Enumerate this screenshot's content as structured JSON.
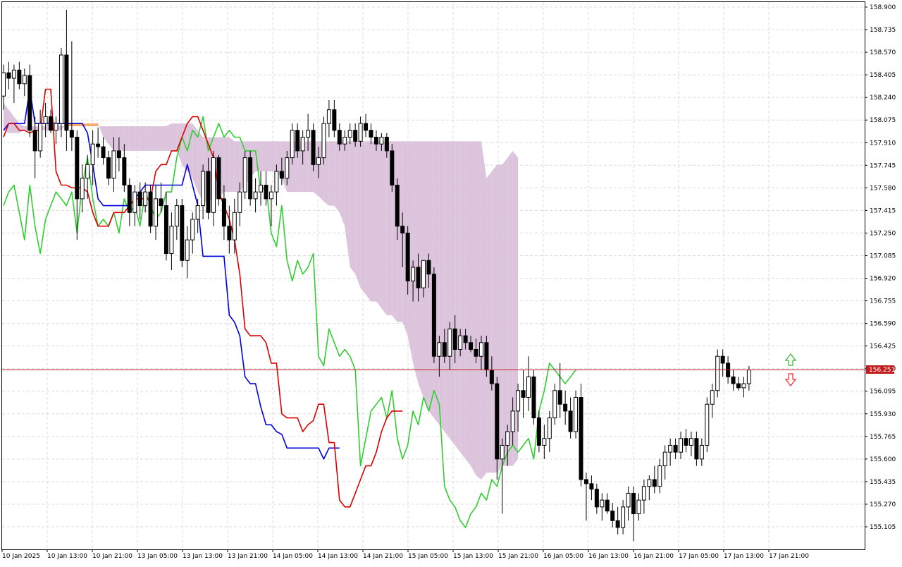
{
  "chart_data": {
    "type": "candlestick",
    "indicator": "Ichimoku Kinko Hyo",
    "current_price": "156.251",
    "price_label": "156.251",
    "ylim": [
      155.0,
      158.95
    ],
    "y_ticks": [
      "158.900",
      "158.735",
      "158.570",
      "158.405",
      "158.240",
      "158.075",
      "157.910",
      "157.745",
      "157.580",
      "157.415",
      "157.250",
      "157.085",
      "156.920",
      "156.755",
      "156.590",
      "156.425",
      "156.260",
      "156.095",
      "155.930",
      "155.765",
      "155.600",
      "155.435",
      "155.270",
      "155.105"
    ],
    "x_ticks": [
      "10 Jan 2025",
      "10 Jan 13:00",
      "10 Jan 21:00",
      "13 Jan 05:00",
      "13 Jan 13:00",
      "13 Jan 21:00",
      "14 Jan 05:00",
      "14 Jan 13:00",
      "14 Jan 21:00",
      "15 Jan 05:00",
      "15 Jan 13:00",
      "15 Jan 21:00",
      "16 Jan 05:00",
      "16 Jan 13:00",
      "16 Jan 21:00",
      "17 Jan 05:00",
      "17 Jan 13:00",
      "17 Jan 21:00"
    ],
    "candles_ohlc": [
      [
        158.25,
        158.48,
        158.15,
        158.42
      ],
      [
        158.42,
        158.5,
        158.3,
        158.38
      ],
      [
        158.38,
        158.48,
        158.2,
        158.44
      ],
      [
        158.44,
        158.5,
        158.3,
        158.34
      ],
      [
        158.34,
        158.45,
        158.25,
        158.4
      ],
      [
        158.4,
        158.48,
        157.95,
        158.0
      ],
      [
        158.0,
        158.1,
        157.65,
        157.85
      ],
      [
        157.85,
        158.15,
        157.8,
        158.05
      ],
      [
        158.05,
        158.2,
        157.95,
        158.1
      ],
      [
        158.1,
        158.15,
        157.98,
        158.0
      ],
      [
        158.0,
        158.1,
        157.9,
        158.05
      ],
      [
        158.05,
        158.6,
        157.95,
        158.55
      ],
      [
        158.55,
        158.88,
        157.85,
        158.0
      ],
      [
        158.0,
        158.65,
        157.85,
        157.95
      ],
      [
        157.95,
        158.0,
        157.2,
        157.5
      ],
      [
        157.5,
        157.75,
        157.4,
        157.65
      ],
      [
        157.65,
        157.82,
        157.5,
        157.75
      ],
      [
        157.75,
        158.0,
        157.6,
        157.9
      ],
      [
        157.9,
        158.02,
        157.8,
        157.88
      ],
      [
        157.88,
        157.95,
        157.75,
        157.8
      ],
      [
        157.8,
        157.85,
        157.6,
        157.65
      ],
      [
        157.65,
        157.95,
        157.55,
        157.85
      ],
      [
        157.85,
        157.95,
        157.7,
        157.8
      ],
      [
        157.8,
        157.9,
        157.55,
        157.6
      ],
      [
        157.6,
        157.65,
        157.3,
        157.4
      ],
      [
        157.4,
        157.6,
        157.3,
        157.55
      ],
      [
        157.55,
        157.62,
        157.35,
        157.45
      ],
      [
        157.45,
        157.62,
        157.4,
        157.55
      ],
      [
        157.55,
        157.6,
        157.25,
        157.3
      ],
      [
        157.3,
        157.6,
        157.2,
        157.5
      ],
      [
        157.5,
        157.62,
        157.4,
        157.45
      ],
      [
        157.45,
        157.55,
        157.05,
        157.1
      ],
      [
        157.1,
        157.4,
        156.98,
        157.3
      ],
      [
        157.3,
        157.5,
        157.2,
        157.45
      ],
      [
        157.45,
        157.5,
        157.0,
        157.05
      ],
      [
        157.05,
        157.3,
        156.92,
        157.2
      ],
      [
        157.2,
        157.4,
        157.1,
        157.35
      ],
      [
        157.35,
        157.5,
        157.25,
        157.45
      ],
      [
        157.45,
        157.75,
        157.35,
        157.7
      ],
      [
        157.7,
        157.8,
        157.35,
        157.4
      ],
      [
        157.4,
        157.85,
        157.3,
        157.8
      ],
      [
        157.8,
        157.82,
        157.45,
        157.5
      ],
      [
        157.5,
        157.6,
        157.2,
        157.3
      ],
      [
        157.3,
        157.45,
        157.1,
        157.2
      ],
      [
        157.2,
        157.5,
        157.1,
        157.4
      ],
      [
        157.4,
        157.62,
        157.3,
        157.55
      ],
      [
        157.55,
        157.85,
        157.5,
        157.8
      ],
      [
        157.8,
        157.85,
        157.45,
        157.5
      ],
      [
        157.5,
        157.65,
        157.4,
        157.55
      ],
      [
        157.55,
        157.7,
        157.45,
        157.6
      ],
      [
        157.6,
        157.7,
        157.45,
        157.5
      ],
      [
        157.5,
        157.6,
        157.3,
        157.55
      ],
      [
        157.55,
        157.75,
        157.45,
        157.7
      ],
      [
        157.7,
        157.8,
        157.6,
        157.65
      ],
      [
        157.65,
        157.85,
        157.6,
        157.8
      ],
      [
        157.8,
        158.05,
        157.75,
        158.0
      ],
      [
        158.0,
        158.05,
        157.8,
        157.85
      ],
      [
        157.85,
        158.0,
        157.75,
        157.95
      ],
      [
        157.95,
        158.12,
        157.85,
        158.0
      ],
      [
        158.0,
        158.05,
        157.7,
        157.75
      ],
      [
        157.75,
        157.88,
        157.65,
        157.8
      ],
      [
        157.8,
        158.1,
        157.75,
        158.05
      ],
      [
        158.05,
        158.22,
        157.95,
        158.15
      ],
      [
        158.15,
        158.22,
        157.95,
        158.0
      ],
      [
        158.0,
        158.05,
        157.85,
        157.9
      ],
      [
        157.9,
        158.0,
        157.85,
        157.95
      ],
      [
        157.95,
        158.05,
        157.9,
        158.0
      ],
      [
        158.0,
        158.05,
        157.88,
        157.92
      ],
      [
        157.92,
        158.1,
        157.88,
        158.05
      ],
      [
        158.05,
        158.12,
        157.95,
        158.0
      ],
      [
        158.0,
        158.05,
        157.9,
        157.95
      ],
      [
        157.95,
        158.0,
        157.85,
        157.9
      ],
      [
        157.9,
        157.98,
        157.85,
        157.95
      ],
      [
        157.95,
        157.98,
        157.8,
        157.85
      ],
      [
        157.85,
        157.9,
        157.55,
        157.6
      ],
      [
        157.6,
        157.65,
        157.2,
        157.3
      ],
      [
        157.3,
        157.4,
        157.0,
        157.25
      ],
      [
        157.25,
        157.3,
        156.8,
        156.9
      ],
      [
        156.9,
        157.05,
        156.75,
        157.0
      ],
      [
        157.0,
        157.1,
        156.75,
        156.85
      ],
      [
        156.85,
        157.05,
        156.78,
        157.05
      ],
      [
        157.05,
        157.1,
        156.85,
        156.95
      ],
      [
        156.95,
        157.0,
        156.3,
        156.35
      ],
      [
        156.35,
        156.5,
        156.2,
        156.45
      ],
      [
        156.45,
        156.55,
        156.3,
        156.35
      ],
      [
        156.35,
        156.6,
        156.25,
        156.55
      ],
      [
        156.55,
        156.65,
        156.3,
        156.4
      ],
      [
        156.4,
        156.55,
        156.35,
        156.5
      ],
      [
        156.5,
        156.55,
        156.4,
        156.45
      ],
      [
        156.45,
        156.5,
        156.38,
        156.4
      ],
      [
        156.4,
        156.48,
        156.3,
        156.35
      ],
      [
        156.35,
        156.5,
        156.25,
        156.45
      ],
      [
        156.45,
        156.5,
        156.2,
        156.25
      ],
      [
        156.25,
        156.35,
        156.1,
        156.15
      ],
      [
        156.15,
        156.2,
        155.45,
        155.6
      ],
      [
        155.6,
        155.75,
        155.2,
        155.7
      ],
      [
        155.7,
        155.85,
        155.55,
        155.8
      ],
      [
        155.8,
        156.05,
        155.7,
        155.95
      ],
      [
        155.95,
        156.15,
        155.8,
        156.1
      ],
      [
        156.1,
        156.25,
        155.9,
        156.05
      ],
      [
        156.05,
        156.35,
        155.95,
        156.2
      ],
      [
        156.2,
        156.25,
        155.85,
        155.9
      ],
      [
        155.9,
        155.95,
        155.65,
        155.7
      ],
      [
        155.7,
        155.85,
        155.6,
        155.75
      ],
      [
        155.75,
        155.95,
        155.65,
        155.9
      ],
      [
        155.9,
        156.15,
        155.85,
        156.1
      ],
      [
        156.1,
        156.3,
        155.9,
        156.0
      ],
      [
        156.0,
        156.1,
        155.85,
        155.95
      ],
      [
        155.95,
        156.05,
        155.75,
        155.8
      ],
      [
        155.8,
        156.1,
        155.75,
        156.05
      ],
      [
        156.05,
        156.15,
        155.4,
        155.45
      ],
      [
        155.45,
        155.5,
        155.15,
        155.42
      ],
      [
        155.42,
        155.48,
        155.3,
        155.38
      ],
      [
        155.38,
        155.42,
        155.2,
        155.25
      ],
      [
        155.25,
        155.35,
        155.15,
        155.3
      ],
      [
        155.3,
        155.35,
        155.2,
        155.22
      ],
      [
        155.22,
        155.28,
        155.1,
        155.15
      ],
      [
        155.15,
        155.25,
        155.05,
        155.1
      ],
      [
        155.1,
        155.3,
        155.05,
        155.25
      ],
      [
        155.25,
        155.4,
        155.15,
        155.35
      ],
      [
        155.35,
        155.4,
        155.0,
        155.2
      ],
      [
        155.2,
        155.35,
        155.15,
        155.3
      ],
      [
        155.3,
        155.45,
        155.2,
        155.4
      ],
      [
        155.4,
        155.48,
        155.3,
        155.45
      ],
      [
        155.45,
        155.55,
        155.35,
        155.4
      ],
      [
        155.4,
        155.6,
        155.35,
        155.55
      ],
      [
        155.55,
        155.7,
        155.45,
        155.65
      ],
      [
        155.65,
        155.75,
        155.55,
        155.7
      ],
      [
        155.7,
        155.75,
        155.6,
        155.65
      ],
      [
        155.65,
        155.8,
        155.6,
        155.75
      ],
      [
        155.75,
        155.82,
        155.65,
        155.7
      ],
      [
        155.7,
        155.8,
        155.62,
        155.75
      ],
      [
        155.75,
        155.8,
        155.55,
        155.6
      ],
      [
        155.6,
        155.75,
        155.55,
        155.7
      ],
      [
        155.7,
        156.05,
        155.65,
        156.0
      ],
      [
        156.0,
        156.15,
        155.9,
        156.1
      ],
      [
        156.1,
        156.4,
        156.05,
        156.35
      ],
      [
        156.35,
        156.4,
        156.2,
        156.3
      ],
      [
        156.3,
        156.35,
        156.15,
        156.2
      ],
      [
        156.2,
        156.25,
        156.1,
        156.15
      ],
      [
        156.15,
        156.2,
        156.1,
        156.12
      ],
      [
        156.12,
        156.2,
        156.05,
        156.15
      ],
      [
        156.15,
        156.28,
        156.1,
        156.25
      ]
    ],
    "tenkan_sen": [
      157.95,
      158.05,
      158.05,
      158.0,
      158.0,
      157.98,
      158.0,
      158.0,
      158.3,
      158.3,
      157.7,
      157.6,
      157.6,
      157.58,
      157.58,
      157.58,
      157.55,
      157.4,
      157.3,
      157.3,
      157.3,
      157.4,
      157.4,
      157.4,
      157.45,
      157.5,
      157.5,
      157.5,
      157.5,
      157.7,
      157.75,
      157.75,
      157.85,
      157.85,
      157.95,
      158.05,
      158.1,
      158.1,
      158.0,
      157.9,
      157.8,
      157.55,
      157.45,
      157.35,
      157.2,
      156.95,
      156.55,
      156.5,
      156.5,
      156.5,
      156.45,
      156.3,
      156.3,
      155.93,
      155.9,
      155.9,
      155.9,
      155.8,
      155.85,
      155.88,
      156.0,
      156.0,
      155.72,
      155.72,
      155.3,
      155.25,
      155.25,
      155.35,
      155.45,
      155.55,
      155.55,
      155.65,
      155.8,
      155.9,
      155.95,
      155.95,
      155.95
    ],
    "kijun_sen": [
      158.0,
      158.05,
      158.05,
      158.05,
      158.05,
      158.3,
      158.05,
      158.05,
      158.05,
      158.05,
      158.05,
      158.05,
      158.05,
      158.05,
      158.05,
      158.05,
      157.98,
      157.75,
      157.5,
      157.45,
      157.45,
      157.45,
      157.45,
      157.45,
      157.45,
      157.5,
      157.55,
      157.6,
      157.6,
      157.6,
      157.6,
      157.6,
      157.6,
      157.6,
      157.6,
      157.75,
      157.6,
      157.45,
      157.08,
      157.08,
      157.08,
      157.08,
      157.08,
      156.65,
      156.6,
      156.5,
      156.2,
      156.15,
      156.15,
      155.98,
      155.85,
      155.85,
      155.8,
      155.78,
      155.68,
      155.68,
      155.68,
      155.68,
      155.68,
      155.68,
      155.68,
      155.6,
      155.68,
      155.68,
      155.68
    ],
    "chikou_span": [
      157.45,
      157.55,
      157.6,
      157.4,
      157.2,
      157.6,
      157.3,
      157.1,
      157.35,
      157.45,
      157.55,
      157.5,
      157.45,
      157.55,
      157.25,
      157.6,
      157.8,
      157.5,
      157.3,
      157.35,
      157.3,
      157.4,
      157.25,
      157.5,
      157.4,
      157.45,
      157.3,
      157.55,
      157.45,
      157.35,
      157.4,
      157.55,
      157.55,
      157.8,
      157.95,
      157.85,
      158.0,
      157.95,
      158.1,
      157.85,
      157.95,
      158.05,
      157.95,
      158.0,
      157.95,
      157.95,
      157.85,
      157.85,
      157.85,
      157.55,
      157.6,
      157.25,
      157.15,
      157.45,
      157.05,
      156.9,
      157.05,
      156.95,
      157.0,
      157.1,
      156.35,
      156.28,
      156.55,
      156.45,
      156.35,
      156.4,
      156.35,
      156.25,
      155.55,
      155.75,
      155.95,
      156.0,
      156.05,
      155.9,
      156.1,
      155.75,
      155.6,
      155.7,
      155.95,
      155.85,
      156.05,
      155.95,
      156.1,
      156.0,
      155.4,
      155.3,
      155.25,
      155.15,
      155.1,
      155.2,
      155.25,
      155.35,
      155.3,
      155.45,
      155.4,
      155.55,
      155.65,
      155.7,
      155.65,
      155.7,
      155.75,
      155.6,
      155.95,
      156.1,
      156.3,
      156.25,
      156.2,
      156.15,
      156.2,
      156.25
    ],
    "kumo_upper": [
      158.2,
      158.15,
      158.1,
      158.05,
      158.03,
      158.03,
      158.03,
      158.03,
      158.03,
      158.1,
      158.05,
      158.03,
      158.03,
      158.03,
      158.03,
      158.03,
      158.03,
      158.03,
      158.03,
      158.03,
      158.03,
      158.03,
      158.03,
      158.03,
      158.03,
      158.03,
      158.03,
      158.03,
      158.03,
      158.03,
      158.03,
      158.03,
      158.05,
      158.05,
      158.05,
      158.05,
      158.05,
      158.0,
      157.95,
      157.95,
      157.95,
      157.95,
      157.95,
      157.95,
      157.92,
      157.92,
      157.92,
      157.92,
      157.92,
      157.92,
      157.92,
      157.92,
      157.92,
      157.92,
      157.92,
      157.92,
      157.92,
      157.92,
      157.92,
      157.92,
      157.92,
      157.92,
      157.92,
      157.92,
      157.92,
      157.92,
      157.92,
      157.92,
      157.92,
      157.92,
      157.92,
      157.92,
      157.92,
      157.92,
      157.92,
      157.92,
      157.92,
      157.92,
      157.92,
      157.92,
      157.92,
      157.92,
      157.92,
      157.92,
      157.92,
      157.92,
      157.92,
      157.92,
      157.92,
      157.92,
      157.92,
      157.92,
      157.65,
      157.7,
      157.75,
      157.75,
      157.8,
      157.85,
      157.8,
      157.6,
      157.5,
      157.45,
      157.4,
      157.4,
      157.4,
      157.3,
      157.0,
      157.0,
      156.9,
      156.75,
      156.75,
      156.75,
      156.75,
      156.7,
      156.6,
      156.6,
      156.55,
      156.55,
      156.5,
      156.45,
      156.45,
      156.45,
      156.45,
      156.4,
      156.1
    ],
    "kumo_lower": [
      158.0,
      157.98,
      157.98,
      157.98,
      158.0,
      158.0,
      158.0,
      158.0,
      158.0,
      158.0,
      158.0,
      158.0,
      158.05,
      158.05,
      158.05,
      158.05,
      158.05,
      158.05,
      158.05,
      157.95,
      157.9,
      157.85,
      157.85,
      157.85,
      157.85,
      157.85,
      157.85,
      157.85,
      157.85,
      157.85,
      157.85,
      157.85,
      157.85,
      157.85,
      157.75,
      157.7,
      157.65,
      157.55,
      157.48,
      157.48,
      157.5,
      157.5,
      157.55,
      157.55,
      157.55,
      157.55,
      157.6,
      157.65,
      157.7,
      157.7,
      157.7,
      157.7,
      157.7,
      157.65,
      157.55,
      157.55,
      157.55,
      157.55,
      157.55,
      157.55,
      157.52,
      157.48,
      157.45,
      157.45,
      157.4,
      157.3,
      157.0,
      156.95,
      156.85,
      156.8,
      156.75,
      156.75,
      156.7,
      156.65,
      156.65,
      156.6,
      156.6,
      156.5,
      156.3,
      156.15,
      156.05,
      155.95,
      155.9,
      155.85,
      155.8,
      155.75,
      155.7,
      155.65,
      155.6,
      155.55,
      155.48,
      155.45,
      155.5,
      155.5,
      155.5,
      155.55,
      155.55,
      155.55,
      155.6
    ]
  }
}
